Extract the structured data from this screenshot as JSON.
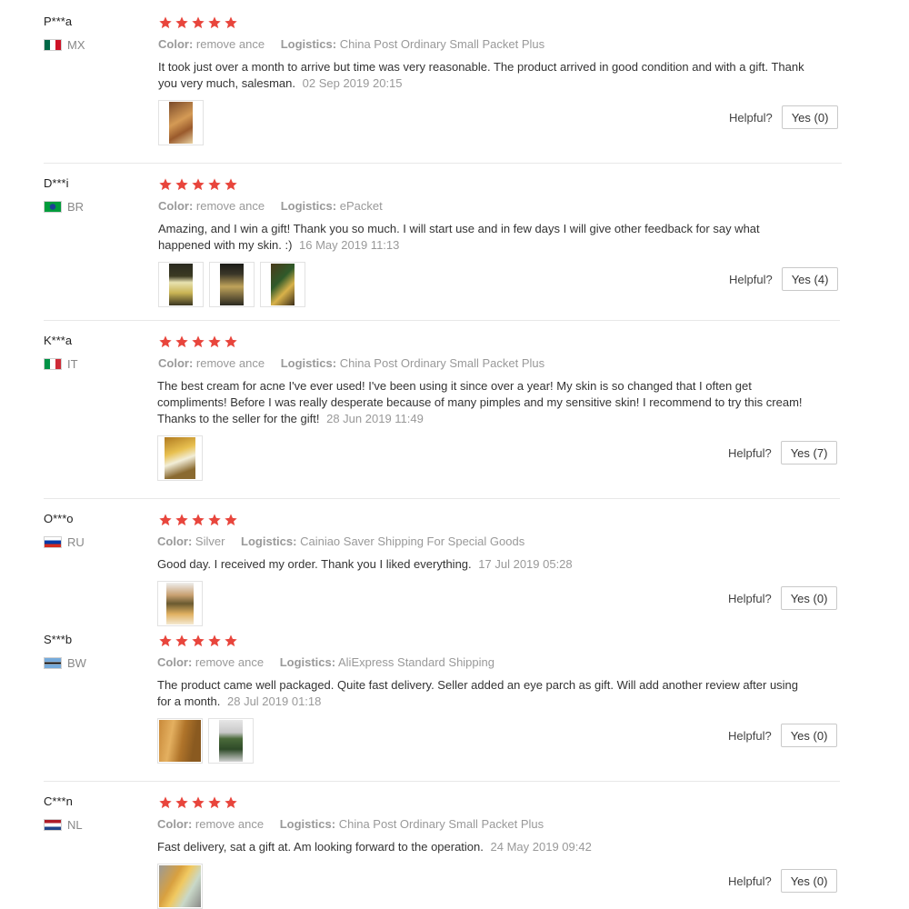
{
  "labels": {
    "color": "Color:",
    "logistics": "Logistics:",
    "helpful": "Helpful?"
  },
  "reviews": [
    {
      "user": "P***a",
      "country": "MX",
      "color": "remove ance",
      "logistics": "China Post Ordinary Small Packet Plus",
      "text": "It took just over a month to arrive but time was very reasonable. The product arrived in good condition and with a gift. Thank you very much, salesman.",
      "date": "02 Sep 2019 20:15",
      "helpful": "Yes (0)",
      "stars": 5,
      "photo_count": 1
    },
    {
      "user": "D***i",
      "country": "BR",
      "color": "remove ance",
      "logistics": "ePacket",
      "text": "Amazing, and I win a gift! Thank you so much. I will start use and in few days I will give other feedback for say what happened with my skin. :)",
      "date": "16 May 2019 11:13",
      "helpful": "Yes (4)",
      "stars": 5,
      "photo_count": 3
    },
    {
      "user": "K***a",
      "country": "IT",
      "color": "remove ance",
      "logistics": "China Post Ordinary Small Packet Plus",
      "text": "The best cream for acne I've ever used! I've been using it since over a year! My skin is so changed that I often get compliments! Before I was really desperate because of many pimples and my sensitive skin! I recommend to try this cream! Thanks to the seller for the gift!",
      "date": "28 Jun 2019 11:49",
      "helpful": "Yes (7)",
      "stars": 5,
      "photo_count": 1
    },
    {
      "user": "O***o",
      "country": "RU",
      "color": "Silver",
      "logistics": "Cainiao Saver Shipping For Special Goods",
      "text": "Good day. I received my order. Thank you I liked everything.",
      "date": "17 Jul 2019 05:28",
      "helpful": "Yes (0)",
      "stars": 5,
      "photo_count": 1
    },
    {
      "user": "S***b",
      "country": "BW",
      "color": "remove ance",
      "logistics": "AliExpress Standard Shipping",
      "text": "The product came well packaged. Quite fast delivery. Seller added an eye parch as gift. Will add another review after using for a month.",
      "date": "28 Jul 2019 01:18",
      "helpful": "Yes (0)",
      "stars": 5,
      "photo_count": 2
    },
    {
      "user": "C***n",
      "country": "NL",
      "color": "remove ance",
      "logistics": "China Post Ordinary Small Packet Plus",
      "text": "Fast delivery, sat a gift at. Am looking forward to the operation.",
      "date": "24 May 2019 09:42",
      "helpful": "Yes (0)",
      "stars": 5,
      "photo_count": 1
    }
  ]
}
